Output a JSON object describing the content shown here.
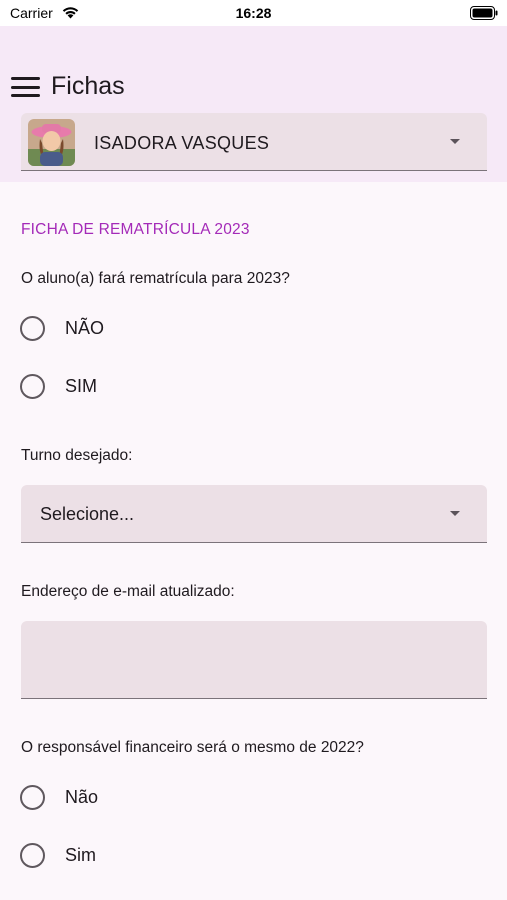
{
  "status_bar": {
    "carrier": "Carrier",
    "time": "16:28",
    "wifi_icon": "wifi-icon",
    "battery_icon": "battery-icon"
  },
  "app_bar": {
    "menu_icon": "hamburger-menu-icon",
    "title": "Fichas",
    "background": "#f6e9f7"
  },
  "student_selector": {
    "name": "ISADORA VASQUES",
    "avatar": "student-photo",
    "arrow_icon": "dropdown-arrow-icon"
  },
  "form": {
    "section_title": "FICHA DE REMATRÍCULA 2023",
    "accent_color": "#a42ab8",
    "q1": {
      "label": "O aluno(a) fará rematrícula para 2023?",
      "options": [
        "NÃO",
        "SIM"
      ]
    },
    "q2": {
      "label": "Turno desejado:",
      "value": "Selecione..."
    },
    "q3": {
      "label": "Endereço de e-mail atualizado:",
      "value": ""
    },
    "q4": {
      "label": "O responsável financeiro será o mesmo de 2022?",
      "options": [
        "Não",
        "Sim"
      ]
    }
  }
}
